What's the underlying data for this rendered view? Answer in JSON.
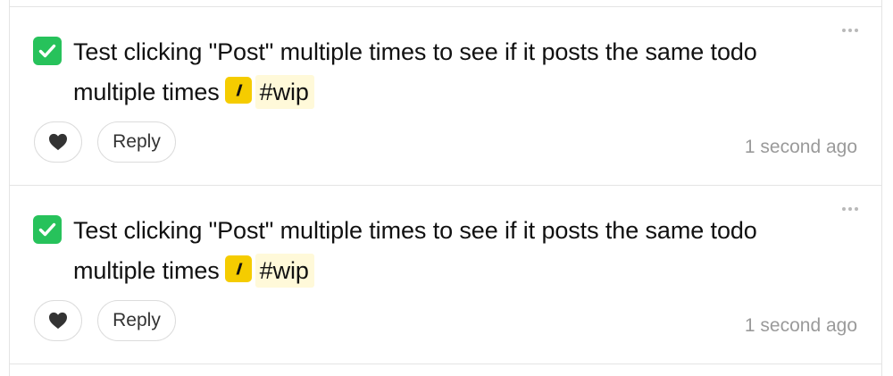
{
  "posts": [
    {
      "completed": true,
      "text": "Test clicking \"Post\" multiple times to see if it posts the same todo multiple times",
      "project_icon": "lightning-bolt-icon",
      "tag": "#wip",
      "reply_label": "Reply",
      "timestamp": "1 second ago"
    },
    {
      "completed": true,
      "text": "Test clicking \"Post\" multiple times to see if it posts the same todo multiple times",
      "project_icon": "lightning-bolt-icon",
      "tag": "#wip",
      "reply_label": "Reply",
      "timestamp": "1 second ago"
    }
  ],
  "colors": {
    "check_green": "#27c25b",
    "project_yellow": "#f5cc00",
    "tag_highlight": "#fff9d9",
    "timestamp_gray": "#9a9a9a",
    "border": "#e4e4e4"
  }
}
